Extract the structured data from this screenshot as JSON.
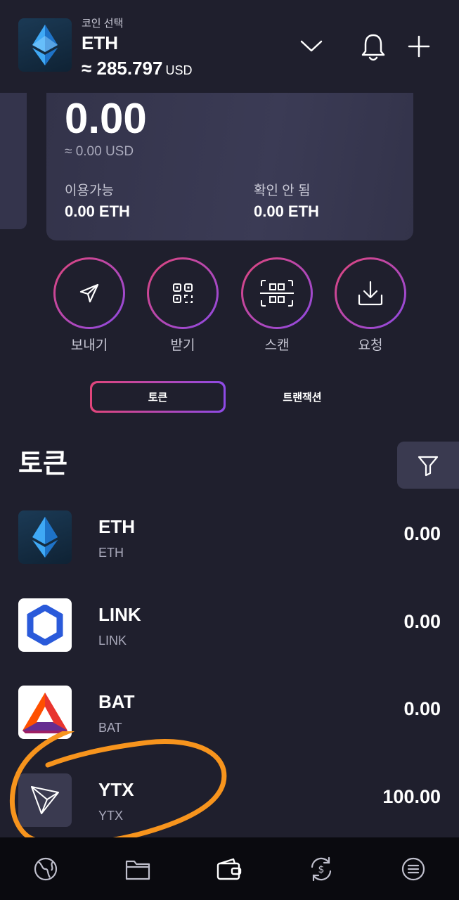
{
  "header": {
    "caption": "코인 선택",
    "symbol": "ETH",
    "value_approx": "≈ 285.797",
    "value_unit": "USD",
    "icons": [
      "chevron-down-icon",
      "bell-icon",
      "plus-icon"
    ]
  },
  "balance": {
    "amount": "0.00",
    "usd": "≈ 0.00 USD",
    "available_label": "이용가능",
    "available_value": "0.00 ETH",
    "unconfirmed_label": "확인 안 됨",
    "unconfirmed_value": "0.00 ETH"
  },
  "actions": [
    {
      "label": "보내기",
      "icon": "send-icon"
    },
    {
      "label": "받기",
      "icon": "qr-code-icon"
    },
    {
      "label": "스캔",
      "icon": "scan-icon"
    },
    {
      "label": "요청",
      "icon": "download-icon"
    }
  ],
  "tabs": [
    {
      "label": "토큰",
      "active": true
    },
    {
      "label": "트랜잭션",
      "active": false
    }
  ],
  "section": {
    "title": "토큰",
    "filter_icon": "filter-icon"
  },
  "tokens": [
    {
      "name": "ETH",
      "sub": "ETH",
      "balance": "0.00",
      "icon": "ethereum-logo"
    },
    {
      "name": "LINK",
      "sub": "LINK",
      "balance": "0.00",
      "icon": "chainlink-logo"
    },
    {
      "name": "BAT",
      "sub": "BAT",
      "balance": "0.00",
      "icon": "bat-logo"
    },
    {
      "name": "YTX",
      "sub": "YTX",
      "balance": "100.00",
      "icon": "tron-logo"
    }
  ],
  "bottom_nav": [
    {
      "icon": "globe-icon"
    },
    {
      "icon": "folder-icon"
    },
    {
      "icon": "wallet-icon"
    },
    {
      "icon": "exchange-icon"
    },
    {
      "icon": "menu-icon"
    }
  ],
  "colors": {
    "background": "#1f1f2d",
    "card": "#35354d",
    "accent_start": "#e0457a",
    "accent_end": "#8d4ae6",
    "annotation": "#f7941d",
    "nav_background": "#0a0a0f"
  }
}
